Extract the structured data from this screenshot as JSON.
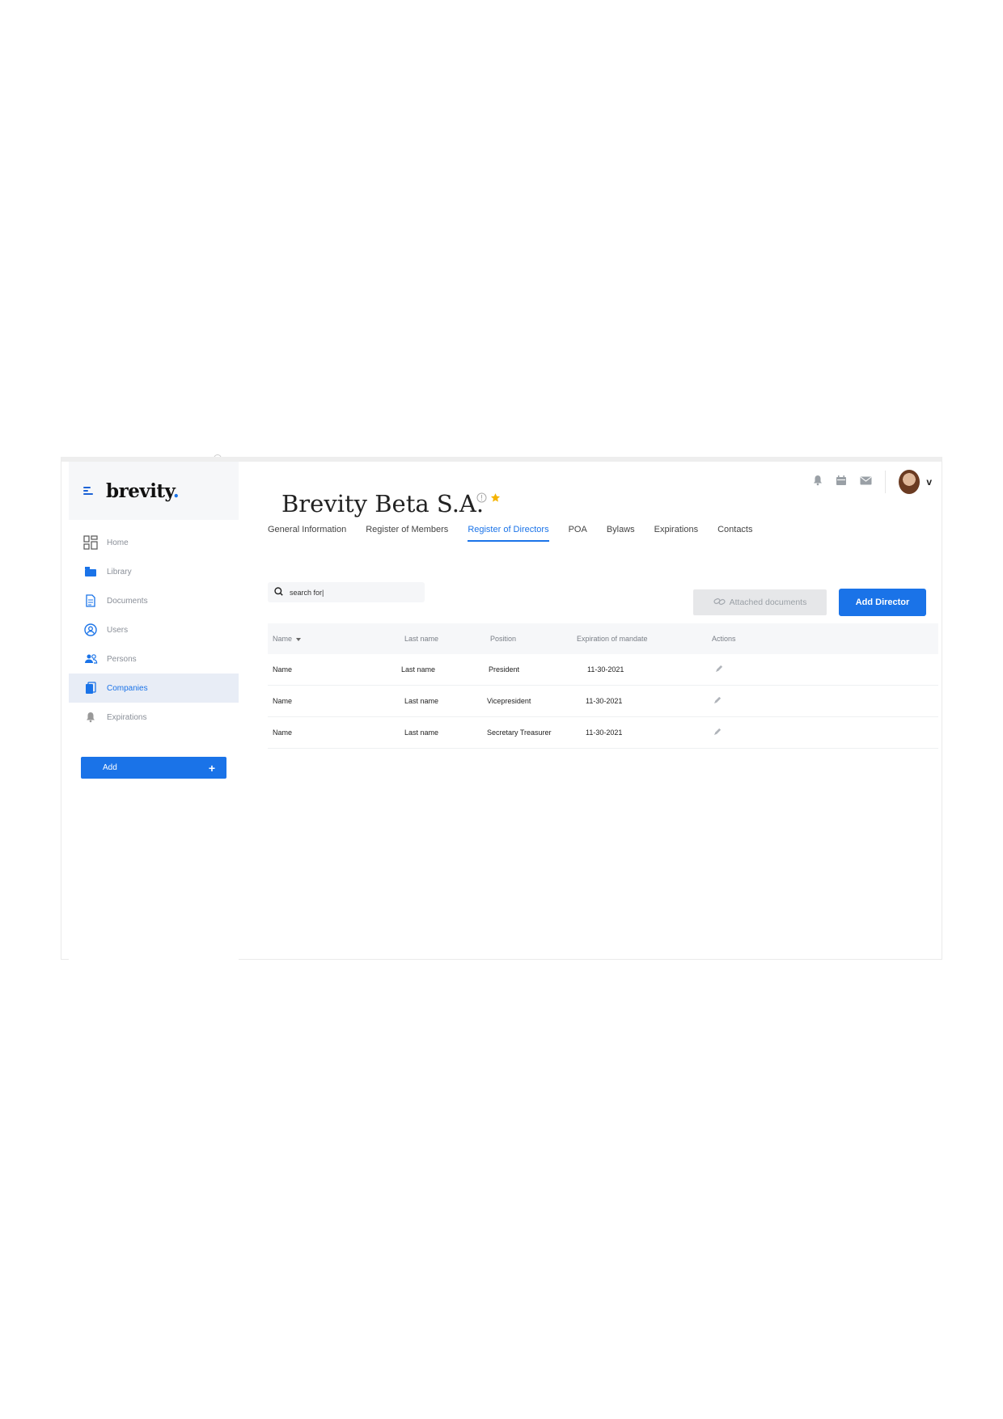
{
  "sidebar": {
    "brand": "brevity",
    "brand_dot": ".",
    "items": [
      {
        "label": "Home",
        "icon": "grid-icon"
      },
      {
        "label": "Library",
        "icon": "folder-icon"
      },
      {
        "label": "Documents",
        "icon": "document-icon"
      },
      {
        "label": "Users",
        "icon": "user-circle-icon"
      },
      {
        "label": "Persons",
        "icon": "people-icon"
      },
      {
        "label": "Companies",
        "icon": "building-icon",
        "active": true
      },
      {
        "label": "Expirations",
        "icon": "bell-icon"
      }
    ],
    "add_label": "Add",
    "add_symbol": "+"
  },
  "header": {
    "company_name": "Brevity Beta S.A.",
    "user_menu_chevron": "v"
  },
  "tabs": [
    {
      "label": "General Information"
    },
    {
      "label": "Register of Members"
    },
    {
      "label": "Register of Directors",
      "active": true
    },
    {
      "label": "POA"
    },
    {
      "label": "Bylaws"
    },
    {
      "label": "Expirations"
    },
    {
      "label": "Contacts"
    }
  ],
  "search": {
    "value": "search for|"
  },
  "actions": {
    "attached_documents": "Attached documents",
    "add_director": "Add Director"
  },
  "table": {
    "columns": [
      "Name",
      "Last name",
      "Position",
      "Expiration of mandate",
      "Actions"
    ],
    "rows": [
      {
        "name": "Name",
        "last_name": "Last name",
        "position": "President",
        "expiration": "11-30-2021"
      },
      {
        "name": "Name",
        "last_name": "Last name",
        "position": "Vicepresident",
        "expiration": "11-30-2021"
      },
      {
        "name": "Name",
        "last_name": "Last name",
        "position": "Secretary Treasurer",
        "expiration": "11-30-2021"
      }
    ]
  },
  "colors": {
    "accent": "#1a73e8",
    "star": "#f5b400",
    "sidebar_active_bg": "#e8edf6"
  }
}
